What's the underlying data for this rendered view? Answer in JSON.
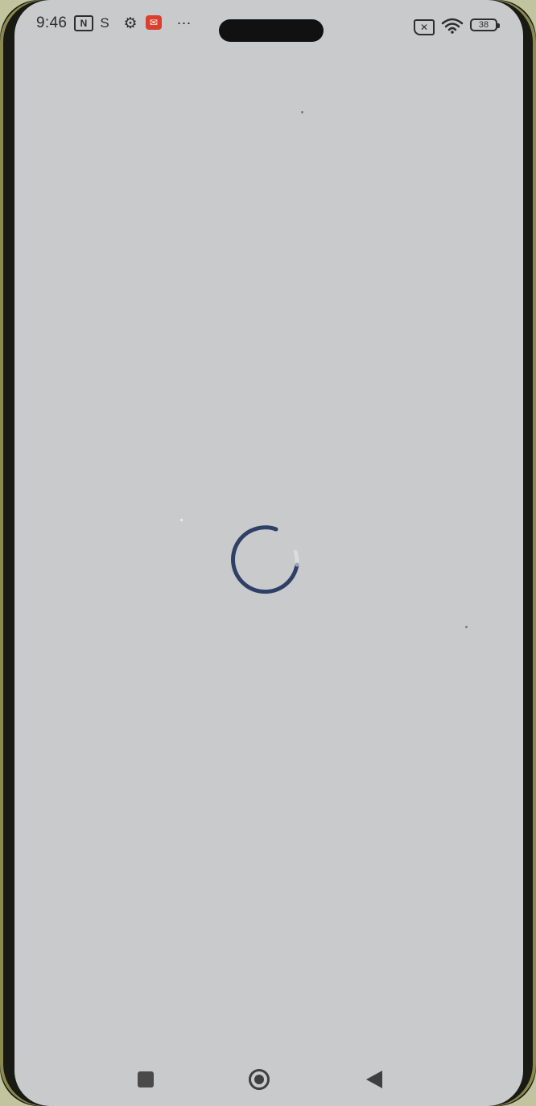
{
  "status_bar": {
    "time": "9:46",
    "battery_level": "38",
    "icons": [
      "nfc-icon",
      "sim-icon",
      "settings-icon",
      "mail-icon",
      "more-icon",
      "no-sim-icon",
      "wifi-icon",
      "battery-icon"
    ]
  },
  "main": {
    "state": "loading",
    "spinner_color": "#2f3f66"
  },
  "nav_bar": {
    "buttons": [
      "recents",
      "home",
      "back"
    ]
  },
  "colors": {
    "screen_background": "#c9cacb",
    "frame": "#1a1a14",
    "mail_badge": "#d9402e"
  }
}
